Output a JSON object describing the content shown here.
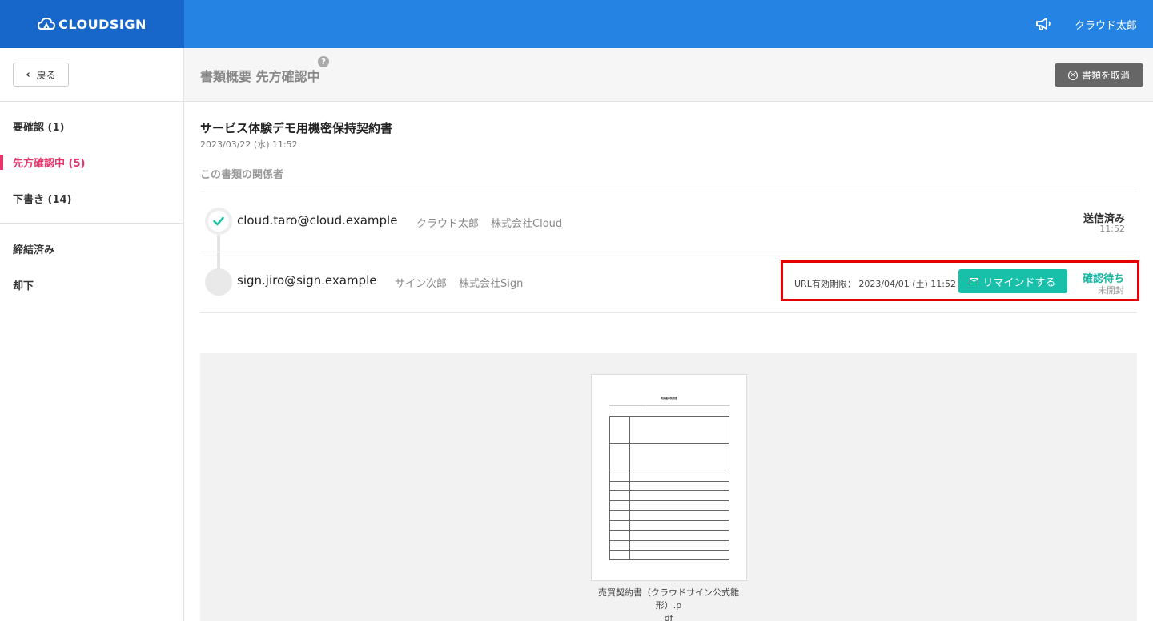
{
  "header": {
    "logo_text": "CLOUDSIGN",
    "username": "クラウド太郎",
    "colors": {
      "topbar": "#2583e3",
      "logo_bg": "#1667c9"
    }
  },
  "sidebar": {
    "back_label": "戻る",
    "items": [
      {
        "label": "要確認 (1)"
      },
      {
        "label": "先方確認中 (5)"
      },
      {
        "label": "下書き (14)"
      },
      {
        "label": "締結済み"
      },
      {
        "label": "却下"
      }
    ],
    "active_color": "#e8336b"
  },
  "titlebar": {
    "title": "書類概要 先方確認中",
    "help": "?",
    "cancel_label": "書類を取消"
  },
  "document": {
    "title": "サービス体験デモ用機密保持契約書",
    "date": "2023/03/22 (水) 11:52",
    "participants_label": "この書類の関係者"
  },
  "participants": [
    {
      "email": "cloud.taro@cloud.example",
      "name": "クラウド太郎",
      "company": "株式会社Cloud",
      "status": "送信済み",
      "time": "11:52"
    },
    {
      "email": "sign.jiro@sign.example",
      "name": "サイン次郎",
      "company": "株式会社Sign",
      "url_expiry": "URL有効期限： 2023/04/01 (土) 11:52",
      "remind_label": "リマインドする",
      "status": "確認待ち",
      "sub_status": "未開封"
    }
  ],
  "file": {
    "thumb_title": "売買基本契約書",
    "name_line1": "売買契約書（クラウドサイン公式雛形）.p",
    "name_line2": "df"
  }
}
